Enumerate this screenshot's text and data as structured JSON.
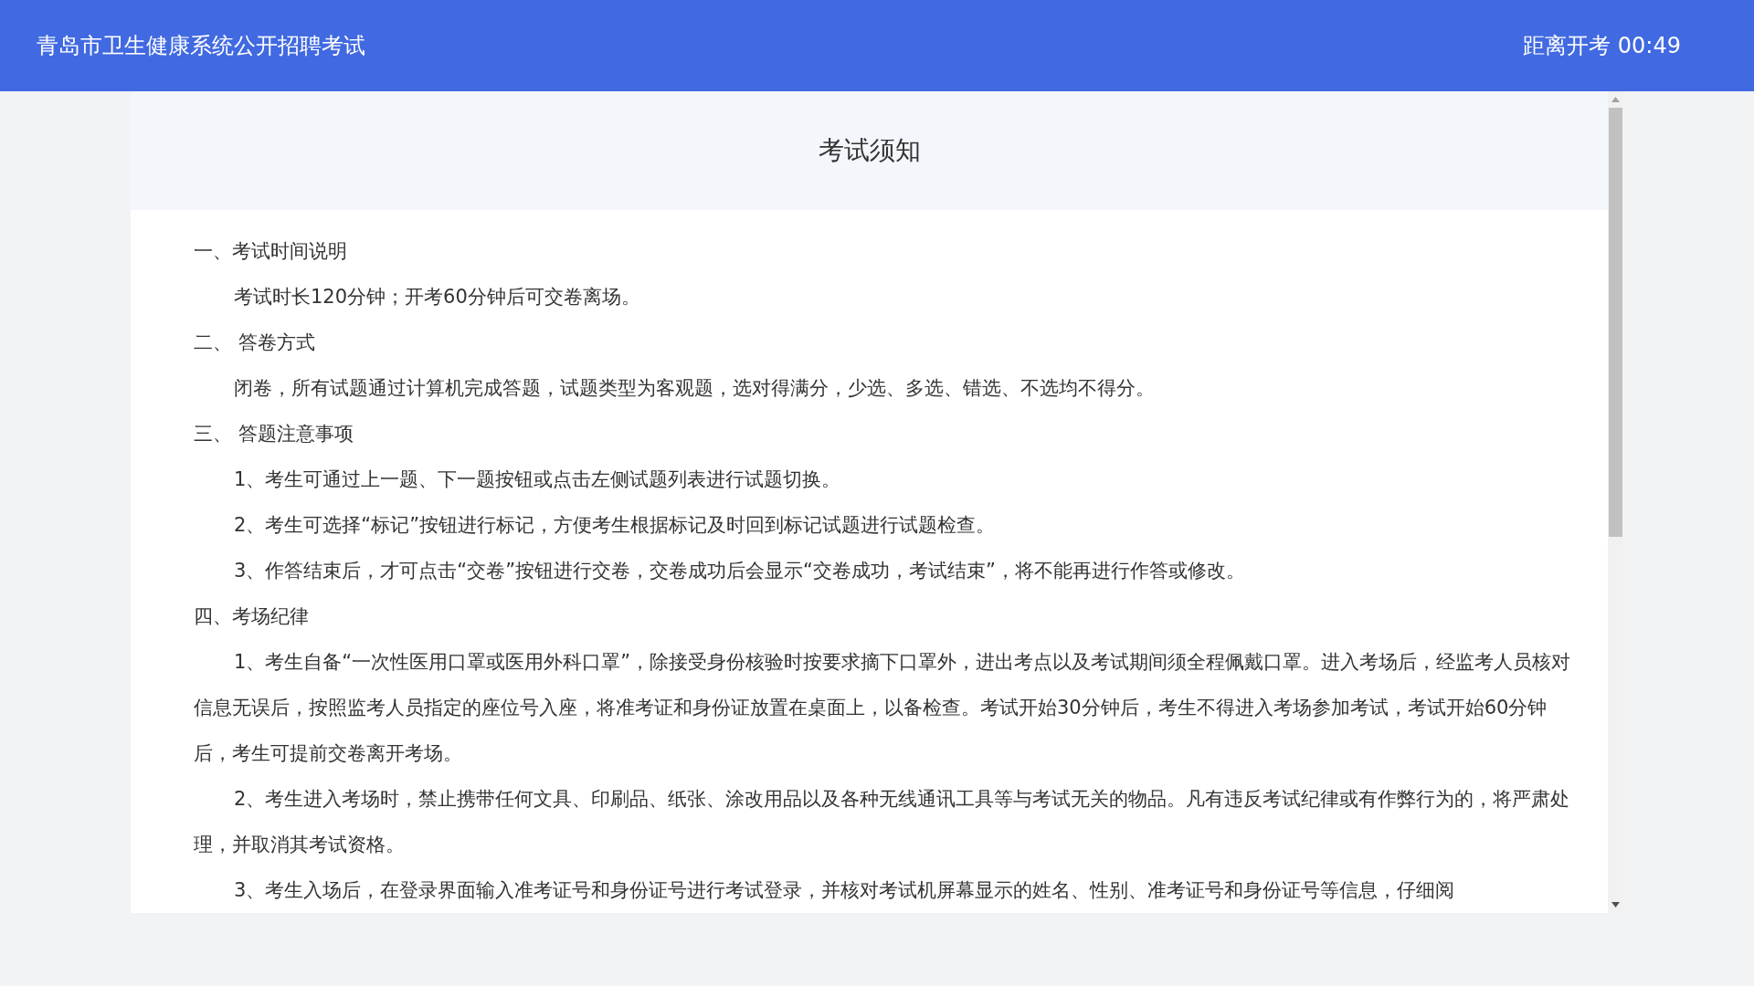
{
  "header": {
    "title": "青岛市卫生健康系统公开招聘考试",
    "countdown": "距离开考 00:49"
  },
  "notice": {
    "title": "考试须知",
    "sections": [
      {
        "heading": "一、考试时间说明",
        "paragraphs": [
          "考试时长120分钟；开考60分钟后可交卷离场。"
        ]
      },
      {
        "heading": "二、 答卷方式",
        "paragraphs": [
          "闭卷，所有试题通过计算机完成答题，试题类型为客观题，选对得满分，少选、多选、错选、不选均不得分。"
        ]
      },
      {
        "heading": "三、 答题注意事项",
        "paragraphs": [
          "1、考生可通过上一题、下一题按钮或点击左侧试题列表进行试题切换。",
          "2、考生可选择“标记”按钮进行标记，方便考生根据标记及时回到标记试题进行试题检查。",
          "3、作答结束后，才可点击“交卷”按钮进行交卷，交卷成功后会显示“交卷成功，考试结束”，将不能再进行作答或修改。"
        ]
      },
      {
        "heading": "四、考场纪律",
        "paragraphs": [
          "1、考生自备“一次性医用口罩或医用外科口罩”，除接受身份核验时按要求摘下口罩外，进出考点以及考试期间须全程佩戴口罩。进入考场后，经监考人员核对信息无误后，按照监考人员指定的座位号入座，将准考证和身份证放置在桌面上，以备检查。考试开始30分钟后，考生不得进入考场参加考试，考试开始60分钟后，考生可提前交卷离开考场。",
          "2、考生进入考场时，禁止携带任何文具、印刷品、纸张、涂改用品以及各种无线通讯工具等与考试无关的物品。凡有违反考试纪律或有作弊行为的，将严肃处理，并取消其考试资格。",
          "3、考生入场后，在登录界面输入准考证号和身份证号进行考试登录，并核对考试机屏幕显示的姓名、性别、准考证号和身份证号等信息，仔细阅"
        ]
      }
    ]
  }
}
